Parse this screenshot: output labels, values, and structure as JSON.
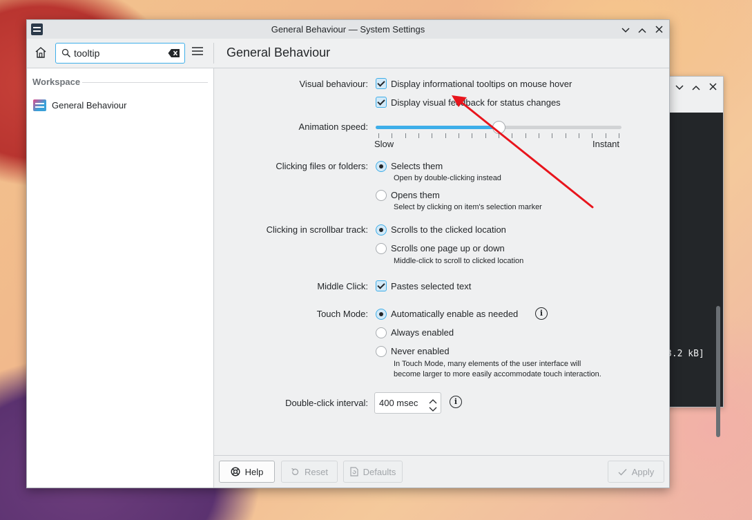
{
  "window": {
    "title": "General Behaviour — System Settings"
  },
  "toolbar": {
    "search_value": "tooltip",
    "page_title": "General Behaviour"
  },
  "sidebar": {
    "header": "Workspace",
    "items": [
      {
        "label": "General Behaviour"
      }
    ]
  },
  "settings": {
    "visual_behaviour": {
      "label": "Visual behaviour:",
      "options": [
        {
          "label": "Display informational tooltips on mouse hover",
          "checked": true
        },
        {
          "label": "Display visual feedback for status changes",
          "checked": true
        }
      ]
    },
    "animation_speed": {
      "label": "Animation speed:",
      "min_label": "Slow",
      "max_label": "Instant",
      "level": 0.5
    },
    "clicking_files": {
      "label": "Clicking files or folders:",
      "options": [
        {
          "label": "Selects them",
          "hint": "Open by double-clicking instead",
          "selected": true
        },
        {
          "label": "Opens them",
          "hint": "Select by clicking on item's selection marker",
          "selected": false
        }
      ]
    },
    "scrollbar_track": {
      "label": "Clicking in scrollbar track:",
      "options": [
        {
          "label": "Scrolls to the clicked location",
          "selected": true
        },
        {
          "label": "Scrolls one page up or down",
          "hint": "Middle-click to scroll to clicked location",
          "selected": false
        }
      ]
    },
    "middle_click": {
      "label": "Middle Click:",
      "option": {
        "label": "Pastes selected text",
        "checked": true
      }
    },
    "touch_mode": {
      "label": "Touch Mode:",
      "options": [
        {
          "label": "Automatically enable as needed",
          "selected": true
        },
        {
          "label": "Always enabled",
          "selected": false
        },
        {
          "label": "Never enabled",
          "selected": false
        }
      ],
      "hint_line1": "In Touch Mode, many elements of the user interface will",
      "hint_line2": "become larger to more easily accommodate touch interaction."
    },
    "double_click": {
      "label": "Double-click interval:",
      "value": "400 msec"
    }
  },
  "footer": {
    "help": "Help",
    "reset": "Reset",
    "defaults": "Defaults",
    "apply": "Apply"
  },
  "background_terminal": {
    "text": "3.2 kB]"
  },
  "colors": {
    "accent": "#3daee9",
    "annotation_arrow": "#e8141c"
  },
  "icons": [
    "app-icon",
    "home-icon",
    "search-icon",
    "clear-icon",
    "hamburger-menu-icon",
    "minimize-icon",
    "maximize-icon",
    "close-icon",
    "info-icon",
    "help-icon",
    "reset-icon",
    "defaults-icon",
    "apply-check-icon"
  ]
}
